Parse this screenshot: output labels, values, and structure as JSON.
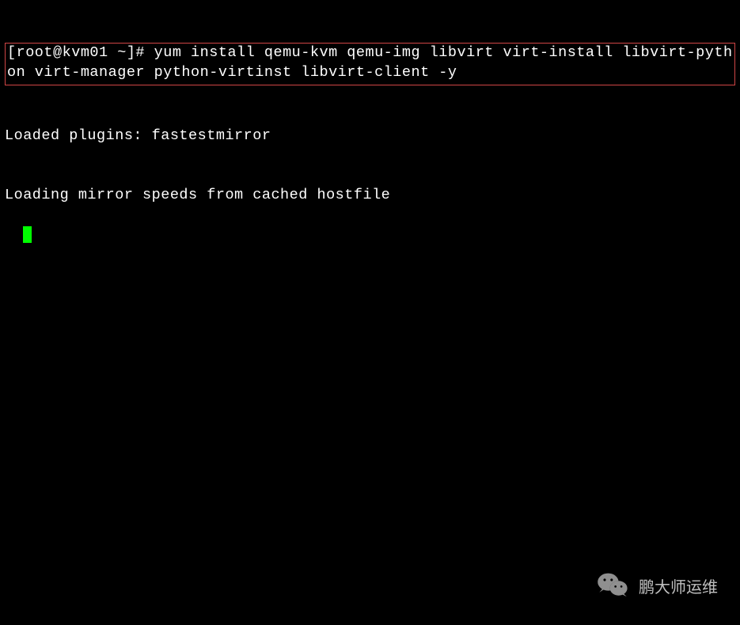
{
  "terminal": {
    "prompt": "[root@kvm01 ~]# ",
    "command": "yum install qemu-kvm qemu-img libvirt virt-install libvirt-python virt-manager python-virtinst libvirt-client -y",
    "output_lines": [
      "Loaded plugins: fastestmirror",
      "Loading mirror speeds from cached hostfile"
    ]
  },
  "watermark": {
    "text": "鹏大师运维"
  }
}
